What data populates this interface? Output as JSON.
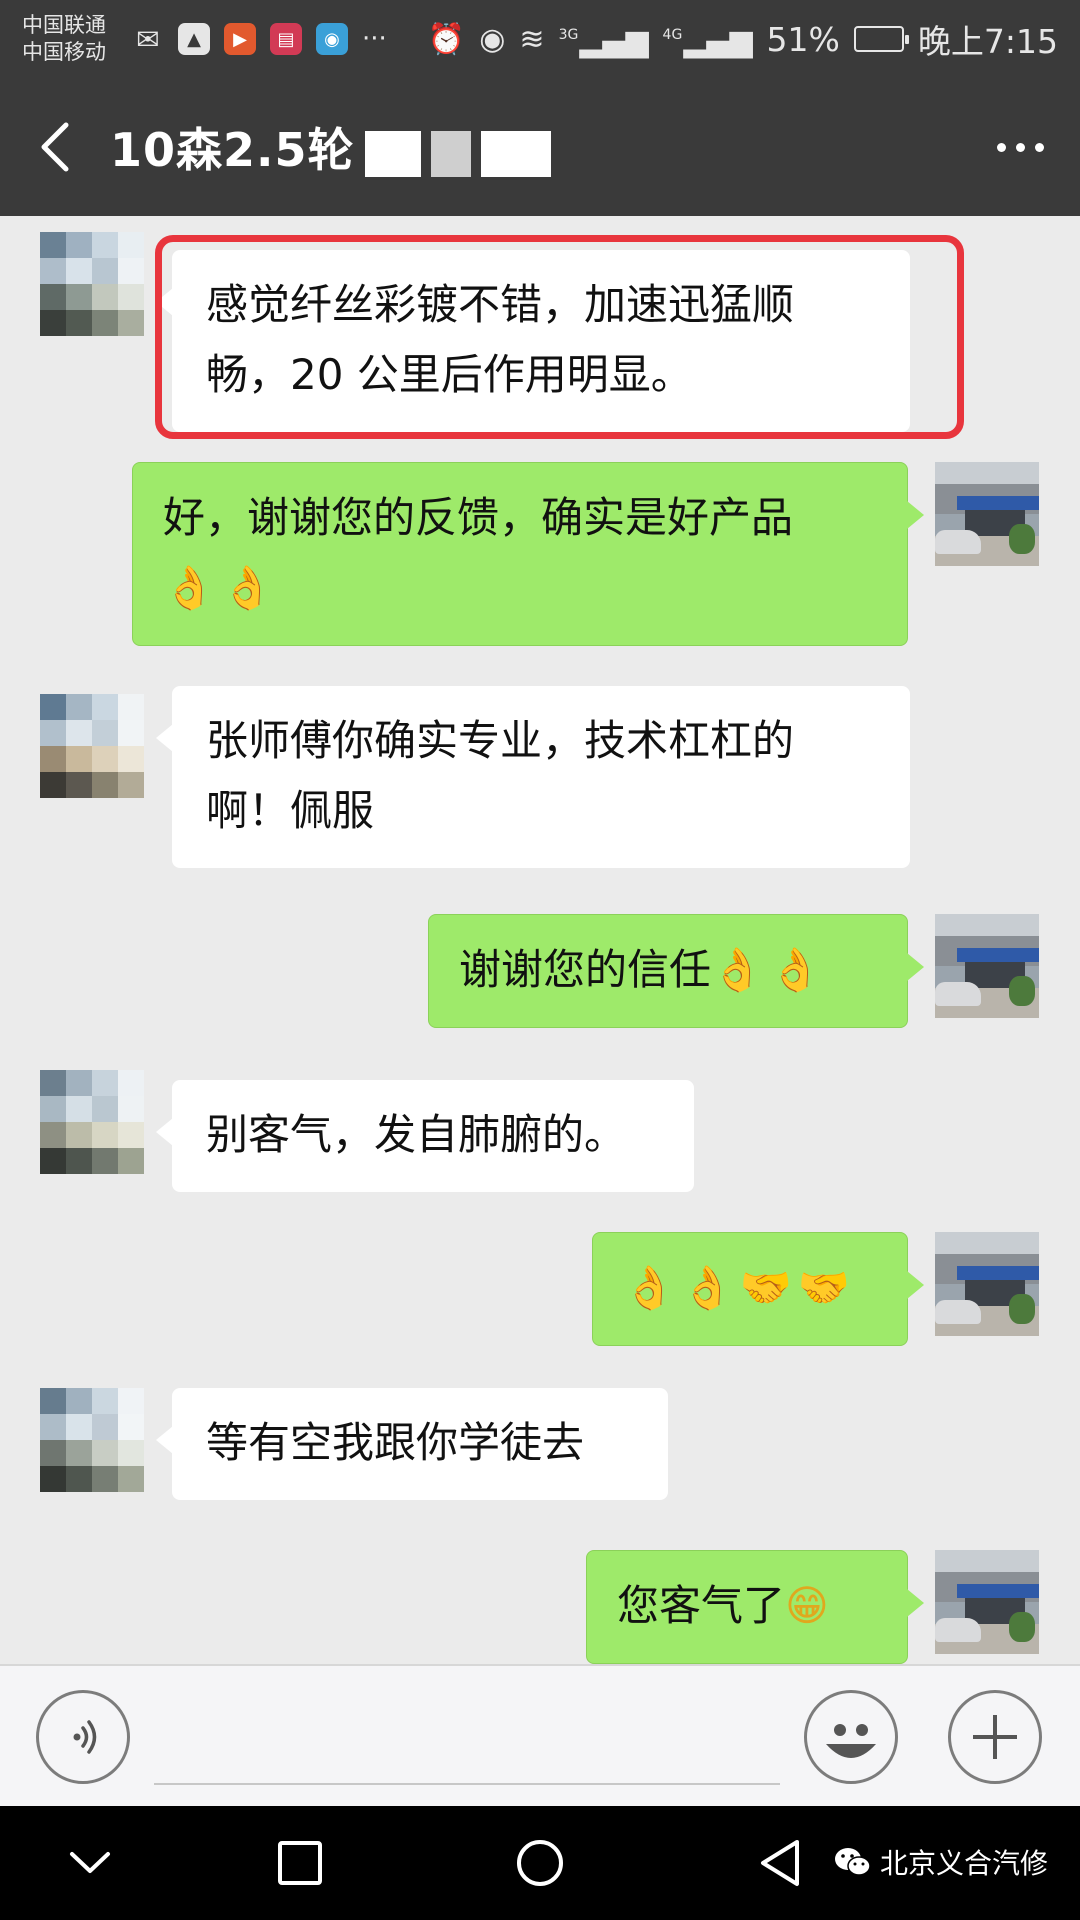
{
  "status_bar": {
    "carrier_1": "中国联通",
    "carrier_2": "中国移动",
    "network_1": "3G",
    "network_2": "4G",
    "battery": "51%",
    "battery_level": 0.51,
    "time": "晚上7:15",
    "more": "···"
  },
  "header": {
    "title": "10森2.5轮"
  },
  "messages": [
    {
      "side": "in",
      "text_line1": "感觉纤丝彩镀不错，加速迅猛顺",
      "text_line2": "畅，20 公里后作用明显。"
    },
    {
      "side": "out",
      "text_line1": "好，谢谢您的反馈，确实是好产品",
      "emoji": "👌👌"
    },
    {
      "side": "in",
      "text_line1": "张师傅你确实专业，技术杠杠的",
      "text_line2": "啊！佩服"
    },
    {
      "side": "out",
      "text_line1": "谢谢您的信任",
      "emoji": "👌👌"
    },
    {
      "side": "in",
      "text_line1": "别客气，发自肺腑的。"
    },
    {
      "side": "out",
      "emoji": "👌👌🤝🤝"
    },
    {
      "side": "in",
      "text_line1": "等有空我跟你学徒去"
    },
    {
      "side": "out",
      "text_line1": "您客气了",
      "emoji": "😁"
    }
  ],
  "input_bar": {
    "voice_icon": "voice-icon",
    "emoji_icon": "emoji-icon",
    "plus_icon": "plus-icon"
  },
  "watermark": {
    "text": "北京义合汽修"
  },
  "colors": {
    "header_bg": "#3a3a3a",
    "chat_bg": "#ebebeb",
    "outgoing_bubble": "#9eea6a",
    "incoming_bubble": "#ffffff",
    "highlight": "#e8353d"
  }
}
